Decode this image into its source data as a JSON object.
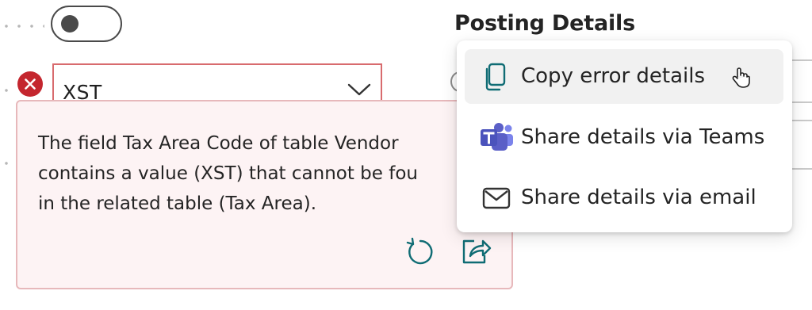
{
  "toggle": {
    "state": "off"
  },
  "tax_area_field": {
    "value": "XST",
    "has_error": true
  },
  "error_callout": {
    "message": "The field Tax Area Code of table Vendor\ncontains a value (XST) that cannot be fou\nin the related table (Tax Area).",
    "actions": [
      {
        "icon": "refresh-icon"
      },
      {
        "icon": "share-icon"
      }
    ]
  },
  "section": {
    "title": "Posting Details"
  },
  "share_menu": {
    "items": [
      {
        "label": "Copy error details",
        "icon": "copy-icon"
      },
      {
        "label": "Share details via Teams",
        "icon": "teams-icon"
      },
      {
        "label": "Share details via email",
        "icon": "mail-icon"
      }
    ]
  },
  "colors": {
    "error": "#c4262e",
    "error_bg": "#fdf3f4",
    "accent": "#0f6c74",
    "teams": "#5b5fc7"
  }
}
